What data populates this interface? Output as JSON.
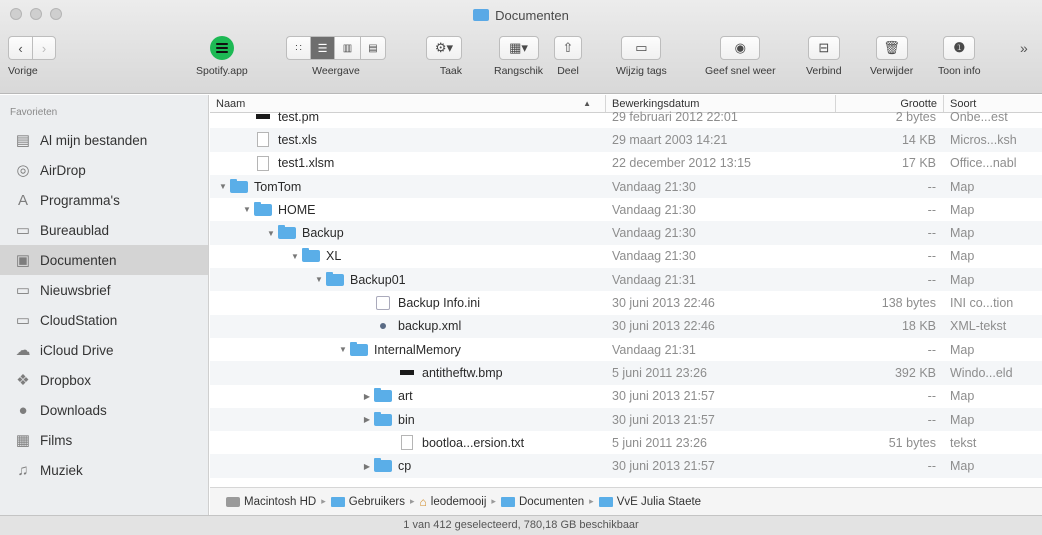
{
  "window": {
    "title": "Documenten"
  },
  "toolbar": {
    "back_label": "Vorige",
    "spotify_label": "Spotify.app",
    "view_label": "Weergave",
    "action_label": "Taak",
    "arrange_label": "Rangschik",
    "share_label": "Deel",
    "tags_label": "Wijzig tags",
    "quicklook_label": "Geef snel weer",
    "connect_label": "Verbind",
    "delete_label": "Verwijder",
    "info_label": "Toon info",
    "overflow": "»"
  },
  "sidebar": {
    "heading": "Favorieten",
    "items": [
      {
        "label": "Al mijn bestanden",
        "icon": "all-files-icon",
        "glyph": "▤"
      },
      {
        "label": "AirDrop",
        "icon": "airdrop-icon",
        "glyph": "◎"
      },
      {
        "label": "Programma's",
        "icon": "applications-icon",
        "glyph": "A"
      },
      {
        "label": "Bureaublad",
        "icon": "desktop-icon",
        "glyph": "▭"
      },
      {
        "label": "Documenten",
        "icon": "documents-icon",
        "glyph": "▣",
        "selected": true
      },
      {
        "label": "Nieuwsbrief",
        "icon": "folder-icon",
        "glyph": "▭"
      },
      {
        "label": "CloudStation",
        "icon": "folder-icon",
        "glyph": "▭"
      },
      {
        "label": "iCloud Drive",
        "icon": "cloud-icon",
        "glyph": "☁"
      },
      {
        "label": "Dropbox",
        "icon": "dropbox-icon",
        "glyph": "❖"
      },
      {
        "label": "Downloads",
        "icon": "downloads-icon",
        "glyph": "●"
      },
      {
        "label": "Films",
        "icon": "movies-icon",
        "glyph": "▦"
      },
      {
        "label": "Muziek",
        "icon": "music-icon",
        "glyph": "♫"
      }
    ]
  },
  "columns": {
    "name": "Naam",
    "date": "Bewerkingsdatum",
    "size": "Grootte",
    "kind": "Soort"
  },
  "rows": [
    {
      "name": "test.pm",
      "date": "29 februari 2012 22:01",
      "size": "2 bytes",
      "kind": "Onbe...est",
      "icon": "bmp",
      "level": 1
    },
    {
      "name": "test.xls",
      "date": "29 maart 2003 14:21",
      "size": "14 KB",
      "kind": "Micros...ksh",
      "icon": "doc",
      "level": 1
    },
    {
      "name": "test1.xlsm",
      "date": "22 december 2012 13:15",
      "size": "17 KB",
      "kind": "Office...nabl",
      "icon": "doc",
      "level": 1
    },
    {
      "name": "TomTom",
      "date": "Vandaag 21:30",
      "size": "--",
      "kind": "Map",
      "icon": "folder",
      "level": 0,
      "disclosure": "open"
    },
    {
      "name": "HOME",
      "date": "Vandaag 21:30",
      "size": "--",
      "kind": "Map",
      "icon": "folder",
      "level": 1,
      "disclosure": "open"
    },
    {
      "name": "Backup",
      "date": "Vandaag 21:30",
      "size": "--",
      "kind": "Map",
      "icon": "folder",
      "level": 2,
      "disclosure": "open"
    },
    {
      "name": "XL",
      "date": "Vandaag 21:30",
      "size": "--",
      "kind": "Map",
      "icon": "folder",
      "level": 3,
      "disclosure": "open"
    },
    {
      "name": "Backup01",
      "date": "Vandaag 21:31",
      "size": "--",
      "kind": "Map",
      "icon": "folder",
      "level": 4,
      "disclosure": "open"
    },
    {
      "name": "Backup Info.ini",
      "date": "30 juni 2013 22:46",
      "size": "138 bytes",
      "kind": "INI co...tion",
      "icon": "ini",
      "level": 6
    },
    {
      "name": "backup.xml",
      "date": "30 juni 2013 22:46",
      "size": "18 KB",
      "kind": "XML-tekst",
      "icon": "xml",
      "level": 6
    },
    {
      "name": "InternalMemory",
      "date": "Vandaag 21:31",
      "size": "--",
      "kind": "Map",
      "icon": "folder",
      "level": 5,
      "disclosure": "open"
    },
    {
      "name": "antitheftw.bmp",
      "date": "5 juni 2011 23:26",
      "size": "392 KB",
      "kind": "Windo...eld",
      "icon": "bmp",
      "level": 7
    },
    {
      "name": "art",
      "date": "30 juni 2013 21:57",
      "size": "--",
      "kind": "Map",
      "icon": "folder",
      "level": 6,
      "disclosure": "closed"
    },
    {
      "name": "bin",
      "date": "30 juni 2013 21:57",
      "size": "--",
      "kind": "Map",
      "icon": "folder",
      "level": 6,
      "disclosure": "closed"
    },
    {
      "name": "bootloa...ersion.txt",
      "date": "5 juni 2011 23:26",
      "size": "51 bytes",
      "kind": "tekst",
      "icon": "doc",
      "level": 7
    },
    {
      "name": "cp",
      "date": "30 juni 2013 21:57",
      "size": "--",
      "kind": "Map",
      "icon": "folder",
      "level": 6,
      "disclosure": "closed"
    }
  ],
  "path": [
    {
      "label": "Macintosh HD",
      "icon": "hdd"
    },
    {
      "label": "Gebruikers",
      "icon": "folder"
    },
    {
      "label": "leodemooij",
      "icon": "home"
    },
    {
      "label": "Documenten",
      "icon": "folder"
    },
    {
      "label": "VvE Julia Staete",
      "icon": "folder"
    }
  ],
  "status": "1 van 412 geselecteerd, 780,18 GB beschikbaar",
  "colors": {
    "folder": "#5aaee8",
    "selection": "#d4d4d4",
    "spotify": "#1db954"
  }
}
